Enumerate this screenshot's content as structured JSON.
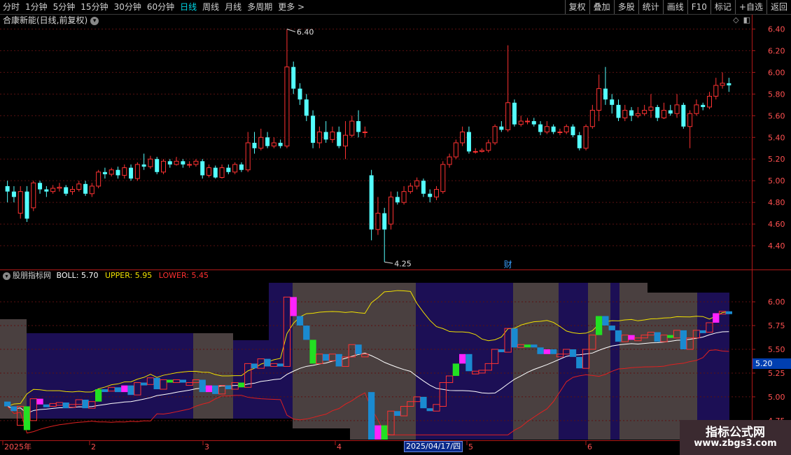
{
  "toolbar": {
    "periods": [
      "分时",
      "1分钟",
      "5分钟",
      "15分钟",
      "30分钟",
      "60分钟",
      "日线",
      "周线",
      "月线",
      "多周期",
      "更多 >"
    ],
    "active_period": "日线",
    "tools": [
      "复权",
      "叠加",
      "多股",
      "统计",
      "画线",
      "F10",
      "标记",
      "+自选",
      "返回"
    ]
  },
  "main_chart": {
    "title": "合康新能(日线,前复权)",
    "title_icon": "chevron-down-icon",
    "price_axis": [
      "6.40",
      "6.20",
      "6.00",
      "5.80",
      "5.60",
      "5.40",
      "5.20",
      "5.00",
      "4.80",
      "4.60",
      "4.40"
    ],
    "high_label": "6.40",
    "low_label": "4.25",
    "finance_marker": "财",
    "up_color": "#ff3232",
    "down_color": "#54ffff"
  },
  "sub_chart": {
    "indicator_name": "股朋指标网",
    "boll_label": "BOLL: 5.70",
    "upper_label": "UPPER: 5.95",
    "lower_label": "LOWER: 5.45",
    "price_axis": [
      "6.00",
      "5.75",
      "5.50",
      "5.25",
      "5.00",
      "4.75"
    ],
    "current_value": "5.20",
    "upper_color": "#f0e000",
    "boll_color": "#ffffff",
    "lower_color": "#e02020"
  },
  "date_axis": {
    "labels": [
      "2025年",
      "2",
      "3",
      "4",
      "5",
      "6"
    ],
    "highlight": "2025/04/17/四"
  },
  "watermark": {
    "line1": "指标公式网",
    "line2": "www.zbgs3.com"
  },
  "chart_data": {
    "type": "candlestick",
    "title": "合康新能(日线,前复权)",
    "ylim": [
      4.2,
      6.5
    ],
    "candles": [
      [
        4.95,
        4.9,
        5.0,
        4.8
      ],
      [
        4.9,
        4.85,
        4.95,
        4.8
      ],
      [
        4.7,
        4.9,
        4.95,
        4.65
      ],
      [
        4.9,
        4.65,
        4.95,
        4.62
      ],
      [
        4.75,
        4.98,
        5.0,
        4.72
      ],
      [
        4.98,
        4.92,
        5.0,
        4.88
      ],
      [
        4.92,
        4.9,
        4.95,
        4.85
      ],
      [
        4.9,
        4.93,
        4.96,
        4.88
      ],
      [
        4.93,
        4.94,
        4.98,
        4.9
      ],
      [
        4.94,
        4.88,
        4.96,
        4.86
      ],
      [
        4.9,
        4.92,
        4.95,
        4.87
      ],
      [
        4.92,
        4.97,
        5.0,
        4.9
      ],
      [
        4.97,
        4.88,
        5.0,
        4.86
      ],
      [
        4.88,
        4.95,
        4.98,
        4.85
      ],
      [
        4.95,
        5.08,
        5.1,
        4.93
      ],
      [
        5.08,
        5.06,
        5.12,
        5.02
      ],
      [
        5.06,
        5.1,
        5.12,
        5.04
      ],
      [
        5.1,
        5.05,
        5.13,
        5.02
      ],
      [
        5.05,
        5.12,
        5.15,
        5.02
      ],
      [
        5.12,
        5.02,
        5.15,
        5.0
      ],
      [
        5.02,
        5.15,
        5.17,
        5.0
      ],
      [
        5.15,
        5.13,
        5.25,
        5.1
      ],
      [
        5.13,
        5.2,
        5.23,
        5.11
      ],
      [
        5.2,
        5.08,
        5.22,
        5.06
      ],
      [
        5.08,
        5.18,
        5.2,
        5.06
      ],
      [
        5.18,
        5.15,
        5.2,
        5.12
      ],
      [
        5.15,
        5.18,
        5.22,
        5.14
      ],
      [
        5.18,
        5.15,
        5.2,
        5.12
      ],
      [
        5.15,
        5.15,
        5.18,
        5.12
      ],
      [
        5.15,
        5.18,
        5.2,
        5.13
      ],
      [
        5.18,
        5.05,
        5.2,
        5.02
      ],
      [
        5.05,
        5.12,
        5.15,
        5.03
      ],
      [
        5.12,
        5.03,
        5.14,
        5.02
      ],
      [
        5.03,
        5.12,
        5.15,
        5.02
      ],
      [
        5.12,
        5.08,
        5.15,
        5.06
      ],
      [
        5.08,
        5.15,
        5.17,
        5.06
      ],
      [
        5.15,
        5.1,
        5.17,
        5.08
      ],
      [
        5.1,
        5.35,
        5.45,
        5.08
      ],
      [
        5.35,
        5.3,
        5.45,
        5.25
      ],
      [
        5.3,
        5.4,
        5.48,
        5.28
      ],
      [
        5.4,
        5.32,
        5.45,
        5.3
      ],
      [
        5.32,
        5.35,
        5.4,
        5.3
      ],
      [
        5.35,
        5.32,
        5.38,
        5.3
      ],
      [
        5.32,
        6.05,
        6.4,
        5.3
      ],
      [
        6.05,
        5.85,
        6.1,
        5.8
      ],
      [
        5.85,
        5.75,
        5.9,
        5.7
      ],
      [
        5.75,
        5.6,
        5.8,
        5.55
      ],
      [
        5.6,
        5.35,
        5.65,
        5.3
      ],
      [
        5.35,
        5.45,
        5.5,
        5.3
      ],
      [
        5.45,
        5.38,
        5.55,
        5.35
      ],
      [
        5.38,
        5.45,
        5.5,
        5.35
      ],
      [
        5.45,
        5.32,
        5.5,
        5.3
      ],
      [
        5.32,
        5.42,
        5.55,
        5.2
      ],
      [
        5.42,
        5.55,
        5.6,
        5.4
      ],
      [
        5.55,
        5.45,
        5.65,
        5.4
      ],
      [
        5.45,
        5.45,
        5.5,
        5.4
      ],
      [
        5.05,
        4.55,
        5.1,
        4.45
      ],
      [
        4.55,
        4.7,
        4.85,
        4.5
      ],
      [
        4.7,
        4.55,
        4.75,
        4.25
      ],
      [
        4.6,
        4.85,
        4.9,
        4.55
      ],
      [
        4.85,
        4.8,
        4.9,
        4.78
      ],
      [
        4.8,
        4.9,
        4.95,
        4.78
      ],
      [
        4.9,
        4.95,
        4.98,
        4.88
      ],
      [
        4.95,
        5.0,
        5.03,
        4.92
      ],
      [
        5.0,
        4.88,
        5.02,
        4.85
      ],
      [
        4.88,
        4.85,
        4.92,
        4.8
      ],
      [
        4.85,
        4.92,
        4.95,
        4.82
      ],
      [
        4.9,
        5.15,
        5.18,
        4.88
      ],
      [
        5.15,
        5.22,
        5.25,
        5.12
      ],
      [
        5.22,
        5.35,
        5.38,
        5.2
      ],
      [
        5.35,
        5.45,
        5.5,
        5.32
      ],
      [
        5.45,
        5.27,
        5.5,
        5.25
      ],
      [
        5.27,
        5.27,
        5.3,
        5.25
      ],
      [
        5.27,
        5.28,
        5.3,
        5.26
      ],
      [
        5.28,
        5.35,
        5.38,
        5.26
      ],
      [
        5.35,
        5.5,
        5.52,
        5.33
      ],
      [
        5.5,
        5.47,
        5.55,
        5.45
      ],
      [
        5.47,
        5.72,
        6.25,
        5.45
      ],
      [
        5.72,
        5.52,
        5.75,
        5.5
      ],
      [
        5.52,
        5.55,
        5.6,
        5.5
      ],
      [
        5.55,
        5.55,
        5.58,
        5.52
      ],
      [
        5.55,
        5.52,
        5.58,
        5.5
      ],
      [
        5.52,
        5.45,
        5.55,
        5.42
      ],
      [
        5.45,
        5.5,
        5.55,
        5.43
      ],
      [
        5.5,
        5.45,
        5.52,
        5.43
      ],
      [
        5.45,
        5.45,
        5.48,
        5.42
      ],
      [
        5.45,
        5.5,
        5.52,
        5.43
      ],
      [
        5.5,
        5.42,
        5.52,
        5.4
      ],
      [
        5.42,
        5.3,
        5.45,
        5.28
      ],
      [
        5.3,
        5.5,
        5.52,
        5.28
      ],
      [
        5.5,
        5.65,
        5.7,
        5.48
      ],
      [
        5.65,
        5.85,
        5.98,
        5.55
      ],
      [
        5.85,
        5.75,
        6.05,
        5.7
      ],
      [
        5.75,
        5.7,
        5.8,
        5.62
      ],
      [
        5.7,
        5.58,
        5.75,
        5.55
      ],
      [
        5.58,
        5.65,
        5.7,
        5.55
      ],
      [
        5.65,
        5.6,
        5.68,
        5.55
      ],
      [
        5.6,
        5.62,
        5.68,
        5.58
      ],
      [
        5.62,
        5.65,
        5.7,
        5.6
      ],
      [
        5.65,
        5.68,
        5.8,
        5.58
      ],
      [
        5.68,
        5.58,
        5.7,
        5.55
      ],
      [
        5.58,
        5.65,
        5.72,
        5.57
      ],
      [
        5.65,
        5.62,
        5.7,
        5.6
      ],
      [
        5.62,
        5.7,
        5.8,
        5.58
      ],
      [
        5.7,
        5.5,
        5.72,
        5.48
      ],
      [
        5.5,
        5.62,
        5.65,
        5.3
      ],
      [
        5.62,
        5.7,
        5.75,
        5.6
      ],
      [
        5.7,
        5.68,
        5.72,
        5.65
      ],
      [
        5.68,
        5.78,
        5.82,
        5.66
      ],
      [
        5.78,
        5.88,
        5.95,
        5.75
      ],
      [
        5.88,
        5.9,
        6.0,
        5.85
      ],
      [
        5.9,
        5.88,
        5.95,
        5.82
      ]
    ]
  }
}
